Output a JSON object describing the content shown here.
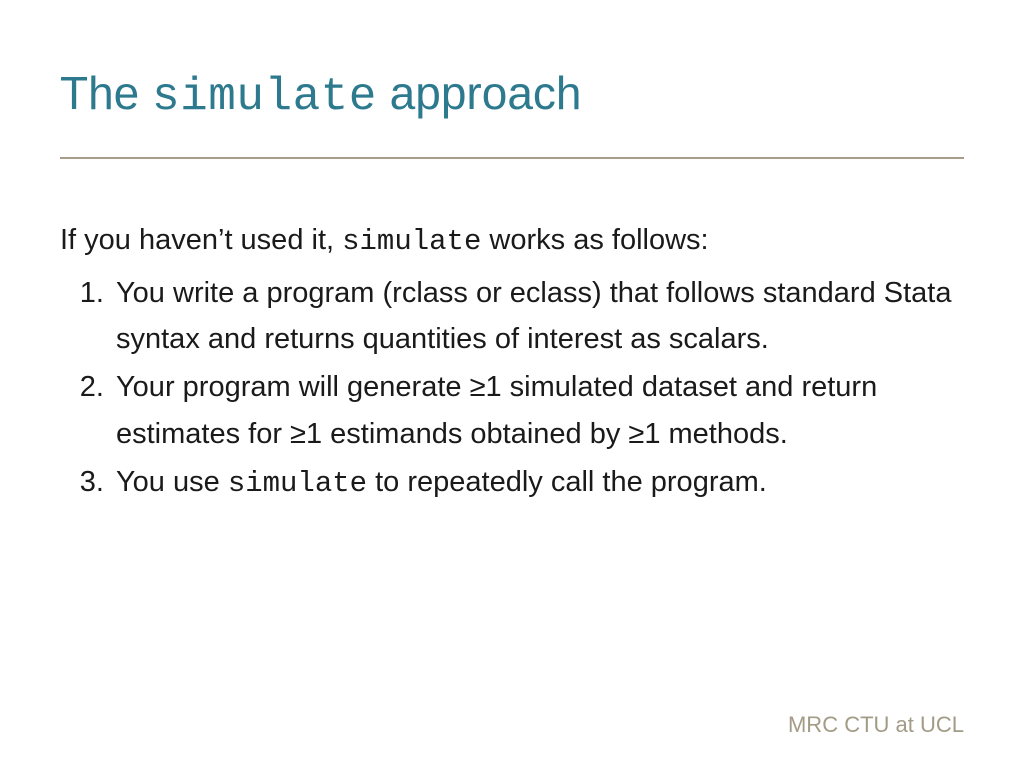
{
  "title": {
    "pre": "The ",
    "mono": "simulate",
    "post": " approach"
  },
  "intro": {
    "pre": "If you haven’t used it, ",
    "mono": "simulate",
    "post": " works as follows:"
  },
  "steps": {
    "s1": "You write a program (rclass or eclass) that follows standard Stata syntax and returns quantities of interest as scalars.",
    "s2": "Your program will generate ≥1 simulated dataset and return estimates for ≥1 estimands obtained by ≥1 methods.",
    "s3_pre": "You use ",
    "s3_mono": "simulate",
    "s3_post": " to repeatedly call the program."
  },
  "footer": "MRC CTU at UCL"
}
